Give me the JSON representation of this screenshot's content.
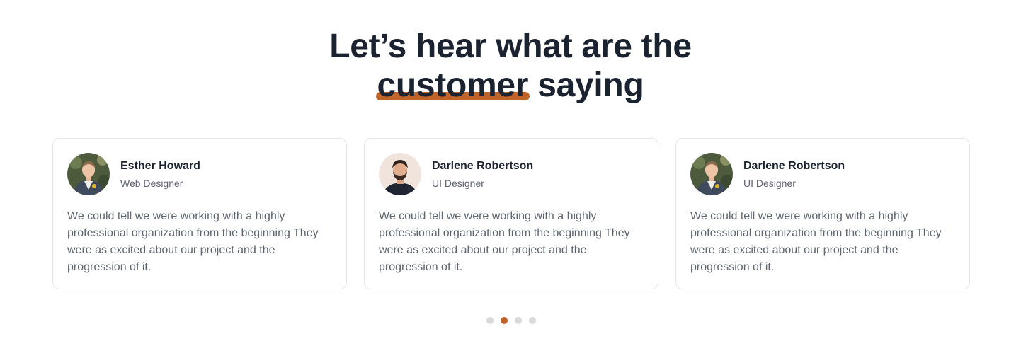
{
  "heading": {
    "line1": "Let’s hear what are the",
    "highlight": "customer",
    "rest": " saying"
  },
  "colors": {
    "accent": "#c0642c",
    "text": "#1b2230",
    "muted": "#5e6470"
  },
  "testimonials": [
    {
      "name": "Esther Howard",
      "role": "Web Designer",
      "avatar": "man-in-suit-avatar",
      "quote": "We could tell we were working with a highly professional organization from the beginning They were as excited about our project and the progression of it."
    },
    {
      "name": "Darlene Robertson",
      "role": "UI Designer",
      "avatar": "bearded-man-avatar",
      "quote": "We could tell we were working with a highly professional organization from the beginning They were as excited about our project and the progression of it."
    },
    {
      "name": "Darlene Robertson",
      "role": "UI Designer",
      "avatar": "man-in-suit-avatar",
      "quote": "We could tell we were working with a highly professional organization from the beginning They were as excited about our project and the progression of it."
    }
  ],
  "pagination": {
    "total": 4,
    "active": 2
  }
}
